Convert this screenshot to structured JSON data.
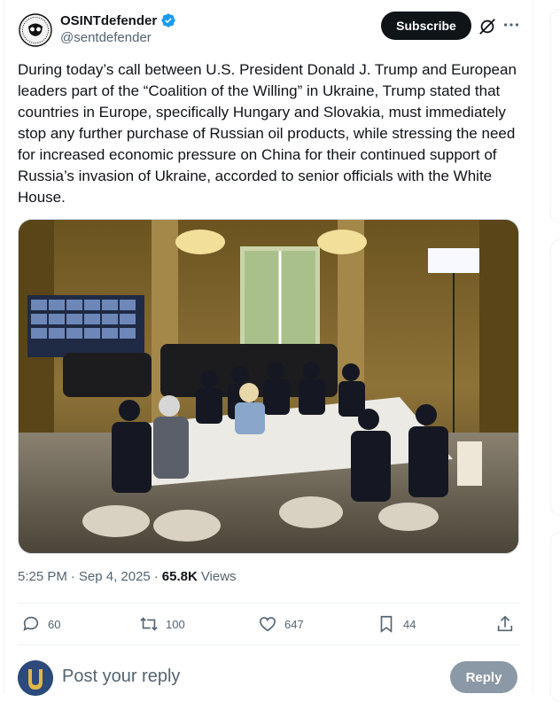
{
  "author": {
    "name": "OSINTdefender",
    "handle": "@sentdefender",
    "verified": true,
    "verified_color": "#1d9bf0"
  },
  "header": {
    "subscribe_label": "Subscribe",
    "grok_icon": "grok-icon",
    "more_icon": "more-icon"
  },
  "post": {
    "text": "During today’s call between U.S. President Donald J. Trump and European leaders part of the “Coalition of the Willing” in Ukraine, Trump stated that countries in Europe, specifically Hungary and Slovakia, must immediately stop any further purchase of Russian oil products, while stressing the need for increased economic pressure on China for their continued support of Russia’s invasion of Ukraine, accorded to senior officials with the White House.",
    "time": "5:25 PM",
    "date": "Sep 4, 2025",
    "views_count": "65.8K",
    "views_label": "Views"
  },
  "actions": {
    "replies": "60",
    "reposts": "100",
    "likes": "647",
    "bookmarks": "44"
  },
  "reply_box": {
    "placeholder": "Post your reply",
    "button_label": "Reply"
  }
}
